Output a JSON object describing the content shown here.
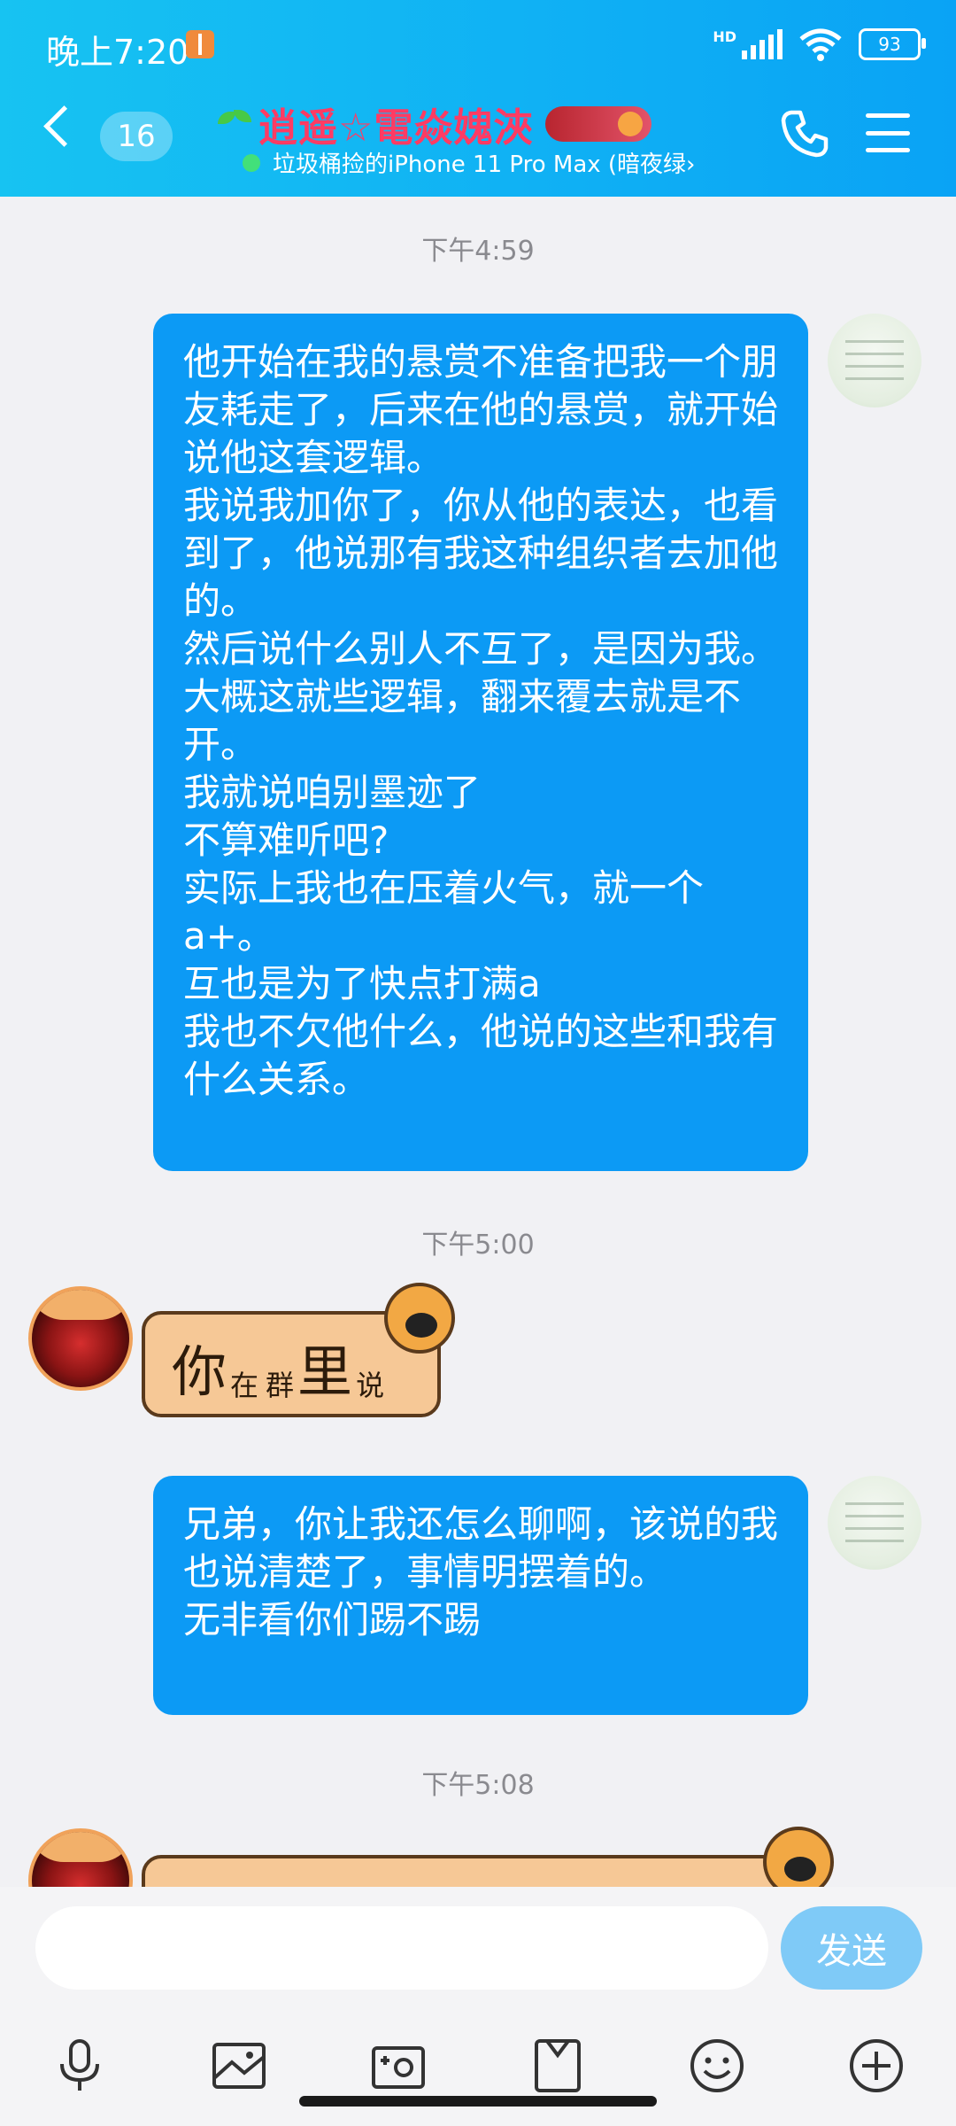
{
  "status_bar": {
    "time": "晚上7:20",
    "network_label": "HD",
    "battery": "93",
    "icons": [
      "gift-icon",
      "signal-icon",
      "wifi-icon",
      "battery-icon"
    ]
  },
  "header": {
    "unread_count": "16",
    "contact_name": "逍遥☆電焱媿浹",
    "device_status": "垃圾桶捡的iPhone 11 Pro Max (暗夜绿›",
    "accent_color": "#12b0f4",
    "name_color": "#ff3b63",
    "icons": [
      "back-icon",
      "sprout-icon",
      "phone-icon",
      "menu-icon"
    ]
  },
  "messages": [
    {
      "type": "timestamp",
      "text": "下午4:59"
    },
    {
      "type": "text",
      "sender": "me",
      "text": "他开始在我的悬赏不准备把我一个朋友耗走了，后来在他的悬赏，就开始说他这套逻辑。\n我说我加你了，你从他的表达，也看到了，他说那有我这种组织者去加他的。\n然后说什么别人不互了，是因为我。\n大概这就些逻辑，翻来覆去就是不开。\n我就说咱别墨迹了\n不算难听吧?\n实际上我也在压着火气，就一个a+。\n互也是为了快点打满a\n我也不欠他什么，他说的这些和我有什么关系。"
    },
    {
      "type": "timestamp",
      "text": "下午5:00"
    },
    {
      "type": "sticker",
      "sender": "other",
      "parts": [
        "你",
        "在",
        "群",
        "里",
        "说"
      ]
    },
    {
      "type": "text",
      "sender": "me",
      "text": "兄弟，你让我还怎么聊啊，该说的我也说清楚了，事情明摆着的。\n无非看你们踢不踢"
    },
    {
      "type": "timestamp",
      "text": "下午5:08"
    },
    {
      "type": "sticker",
      "sender": "other",
      "parts": []
    }
  ],
  "input": {
    "placeholder": "",
    "send_label": "发送",
    "send_color": "#7fcaf7"
  },
  "toolbar": {
    "icons": [
      "microphone-icon",
      "image-icon",
      "camera-icon",
      "file-icon",
      "emoji-icon",
      "plus-icon"
    ]
  },
  "colors": {
    "bubble_out": "#0c9af5",
    "chat_bg": "#f1f1f4",
    "timestamp": "#8a8a8f"
  }
}
